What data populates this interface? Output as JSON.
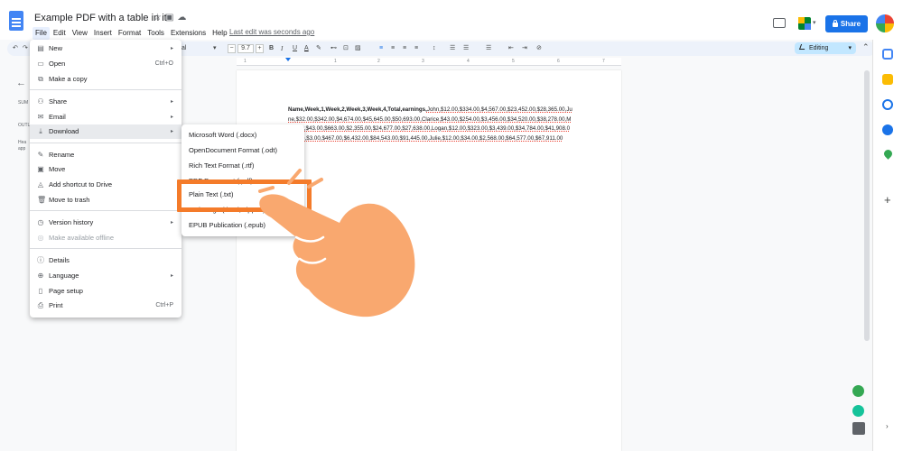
{
  "header": {
    "doc_title": "Example PDF with a table in it",
    "last_edit": "Last edit was seconds ago",
    "share_label": "Share",
    "icons": [
      "star-icon",
      "move-to-folder-icon",
      "cloud-status-icon",
      "comment-history-icon",
      "meet-icon",
      "lock-icon",
      "account-avatar"
    ]
  },
  "menubar": [
    "File",
    "Edit",
    "View",
    "Insert",
    "Format",
    "Tools",
    "Extensions",
    "Help"
  ],
  "toolbar": {
    "font_tail": "al",
    "font_size": "9.7",
    "minus": "−",
    "plus": "+",
    "bold": "B",
    "italic": "I",
    "underline": "U",
    "text_color": "A",
    "mode": "Editing"
  },
  "ruler": {
    "numbers": [
      "1",
      "1",
      "2",
      "3",
      "4",
      "5",
      "6",
      "7"
    ]
  },
  "outline": {
    "summary_label": "SUM",
    "outline_label": "OUTL",
    "hint_line1": "Hea",
    "hint_line2": "app"
  },
  "file_menu": {
    "items": [
      {
        "label": "New",
        "shortcut": "",
        "arrow": "▸"
      },
      {
        "label": "Open",
        "shortcut": "Ctrl+O",
        "arrow": ""
      },
      {
        "label": "Make a copy",
        "shortcut": "",
        "arrow": ""
      },
      {
        "label": "Share",
        "shortcut": "",
        "arrow": "▸"
      },
      {
        "label": "Email",
        "shortcut": "",
        "arrow": "▸"
      },
      {
        "label": "Download",
        "shortcut": "",
        "arrow": "▸"
      },
      {
        "label": "Rename",
        "shortcut": "",
        "arrow": ""
      },
      {
        "label": "Move",
        "shortcut": "",
        "arrow": ""
      },
      {
        "label": "Add shortcut to Drive",
        "shortcut": "",
        "arrow": ""
      },
      {
        "label": "Move to trash",
        "shortcut": "",
        "arrow": ""
      },
      {
        "label": "Version history",
        "shortcut": "",
        "arrow": "▸"
      },
      {
        "label": "Make available offline",
        "shortcut": "",
        "arrow": ""
      },
      {
        "label": "Details",
        "shortcut": "",
        "arrow": ""
      },
      {
        "label": "Language",
        "shortcut": "",
        "arrow": "▸"
      },
      {
        "label": "Page setup",
        "shortcut": "",
        "arrow": ""
      },
      {
        "label": "Print",
        "shortcut": "Ctrl+P",
        "arrow": ""
      }
    ]
  },
  "download_menu": {
    "items": [
      "Microsoft Word (.docx)",
      "OpenDocument Format (.odt)",
      "Rich Text Format (.rtf)",
      "PDF Document (.pdf)",
      "Plain Text (.txt)",
      "Web Page (.html, zipped)",
      "EPUB Publication (.epub)"
    ]
  },
  "document": {
    "bold_header": "Name,Week,1,Week,2,Week,3,Week,4,Total,earnings,",
    "body": "John,$12.00,$334.00,$4,567.00,$23,452.00,$28,365.00,June,$32.00,$342.00,$4,674.00,$45,645.00,$50,693.00,Clarice,$43.00,$254.00,$3,456.00,$34,520.00,$38,278.00,Matthew,$43.00,$663.00,$2,355.00,$24,677.00,$27,638.00,Logan,$12.00,$323.00,$3,439.00,$34,784.00,$41,908.00,Alice,$3.00,$467.00,$6,432.00,$84,543.00,$91,445.00,Julie,$12.00,$34.00,$2,568.00,$64,577.00,$67,911.00"
  },
  "colors": {
    "accent": "#1a73e8",
    "highlight": "#f47b2a",
    "hand": "#f9a86f"
  }
}
